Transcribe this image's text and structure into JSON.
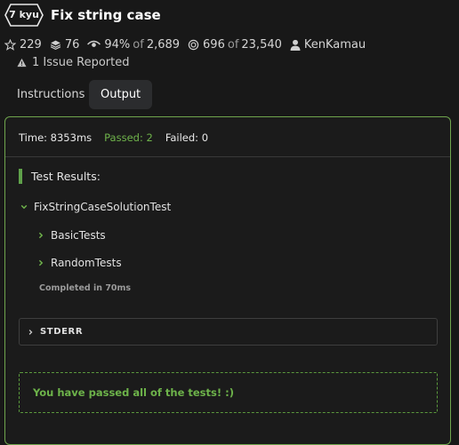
{
  "kata": {
    "rank": "7 kyu",
    "title": "Fix string case"
  },
  "stats": {
    "stars": "229",
    "collections": "76",
    "satisfaction_percent": "94%",
    "satisfaction_of": "of",
    "satisfaction_votes": "2,689",
    "completed": "696",
    "completed_of": "of",
    "completed_total": "23,540",
    "author": "KenKamau"
  },
  "issues": "1 Issue Reported",
  "tabs": [
    {
      "label": "Instructions",
      "active": false
    },
    {
      "label": "Output",
      "active": true
    }
  ],
  "output": {
    "time": "Time: 8353ms",
    "passed": "Passed: 2",
    "failed": "Failed: 0",
    "results_header": "Test Results:",
    "suite": {
      "name": "FixStringCaseSolutionTest",
      "tests": [
        "BasicTests",
        "RandomTests"
      ],
      "completed": "Completed in 70ms"
    },
    "stderr_label": "STDERR",
    "pass_message": "You have passed all of the tests! :)"
  },
  "colors": {
    "background": "#181818",
    "accent_green": "#6fb34b",
    "panel_border": "#6fa54d"
  },
  "icons": {
    "rank": "hexagon-badge",
    "stars": "star-outline-icon",
    "collections": "layers-icon",
    "satisfaction": "eye-icon",
    "completed": "target-icon",
    "author": "user-icon",
    "issue": "warning-triangle-icon",
    "suite": "chevron-down-icon",
    "test": "chevron-right-icon",
    "stderr": "chevron-right-icon"
  }
}
